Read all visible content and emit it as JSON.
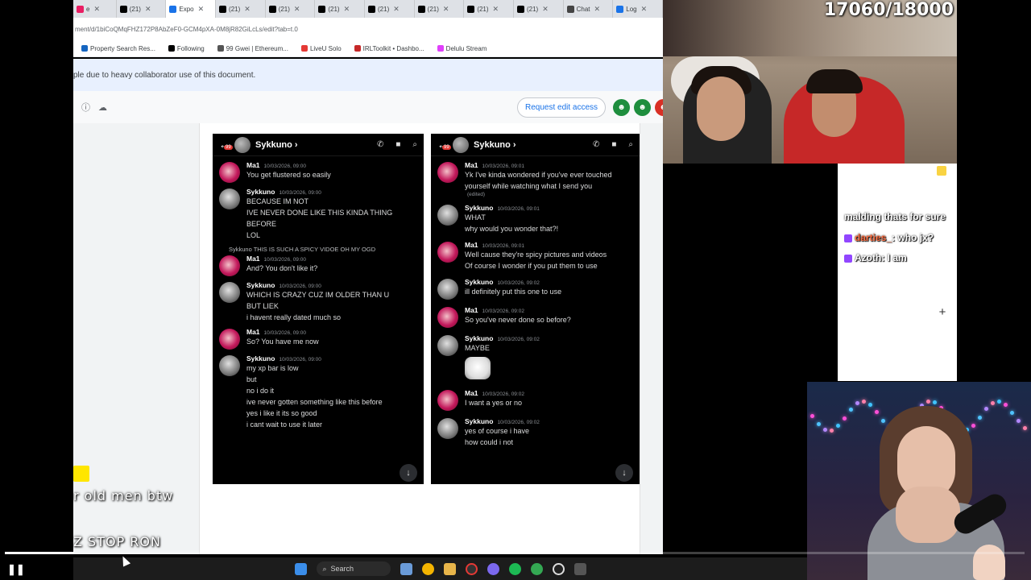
{
  "tabs": [
    {
      "label": "e",
      "active": false,
      "color": "#e91e63"
    },
    {
      "label": "(21)",
      "active": false,
      "color": "#000000"
    },
    {
      "label": "Expo",
      "active": true,
      "color": "#1a73e8"
    },
    {
      "label": "(21)",
      "active": false,
      "color": "#000000"
    },
    {
      "label": "(21)",
      "active": false,
      "color": "#000000"
    },
    {
      "label": "(21)",
      "active": false,
      "color": "#000000"
    },
    {
      "label": "(21)",
      "active": false,
      "color": "#000000"
    },
    {
      "label": "(21)",
      "active": false,
      "color": "#000000"
    },
    {
      "label": "(21)",
      "active": false,
      "color": "#000000"
    },
    {
      "label": "(21)",
      "active": false,
      "color": "#000000"
    },
    {
      "label": "Chat",
      "active": false,
      "color": "#444444"
    },
    {
      "label": "Log",
      "active": false,
      "color": "#1a73e8"
    }
  ],
  "address": {
    "url": "ment/d/1biCoQMqFHZ172P8AbZeF0-GCM4pXA-0M8jR82GiLcLs/edit?tab=t.0"
  },
  "bookmarks": [
    {
      "label": "Property Search Res...",
      "color": "#1565c0"
    },
    {
      "label": "Following",
      "color": "#000000"
    },
    {
      "label": "99 Gwei | Ethereum...",
      "color": "#555555"
    },
    {
      "label": "LiveU Solo",
      "color": "#e53935"
    },
    {
      "label": "IRLToolkit • Dashbo...",
      "color": "#c62828"
    },
    {
      "label": "Delulu Stream",
      "color": "#e040fb"
    }
  ],
  "notice": {
    "text": "ple due to heavy collaborator use of this document."
  },
  "doc_toolbar": {
    "request_label": "Request edit access"
  },
  "chat_left": {
    "contact": "Sykkuno",
    "badge": "99",
    "messages": [
      {
        "author": "Ma1",
        "time": "10/03/2026, 09:00",
        "lines": [
          "You get flustered so easily"
        ]
      },
      {
        "author": "Sykkuno",
        "time": "10/03/2026, 09:00",
        "lines": [
          "BECAUSE IM NOT",
          "IVE NEVER DONE LIKE THIS KINDA THING",
          "BEFORE",
          "LOL"
        ]
      },
      {
        "author": "Ma1",
        "time": "10/03/2026, 09:00",
        "lines": [
          "And? You don't like it?"
        ],
        "reply": "Sykkuno THIS IS SUCH A SPICY VIDOE OH MY OGD"
      },
      {
        "author": "Sykkuno",
        "time": "10/03/2026, 09:00",
        "lines": [
          "WHICH IS CRAZY CUZ IM OLDER THAN U",
          "BUT LIEK",
          "i havent really dated much so"
        ]
      },
      {
        "author": "Ma1",
        "time": "10/03/2026, 09:00",
        "lines": [
          "So? You have me now"
        ]
      },
      {
        "author": "Sykkuno",
        "time": "10/03/2026, 09:00",
        "lines": [
          "my xp bar is low",
          "but",
          "no i do it",
          "ive never gotten something like this before",
          "yes i like it its so good",
          "i cant wait to use it later"
        ]
      }
    ]
  },
  "chat_right": {
    "contact": "Sykkuno",
    "badge": "99",
    "messages": [
      {
        "author": "Ma1",
        "time": "10/03/2026, 09:01",
        "lines": [
          "Yk I've kinda wondered if you've ever touched",
          "yourself while watching what I send you"
        ],
        "edited": "(edited)"
      },
      {
        "author": "Sykkuno",
        "time": "10/03/2026, 09:01",
        "lines": [
          "WHAT",
          "why would you wonder that?!"
        ]
      },
      {
        "author": "Ma1",
        "time": "10/03/2026, 09:01",
        "lines": [
          "Well cause they're spicy pictures and videos",
          "Of course I wonder if you put them to use"
        ]
      },
      {
        "author": "Sykkuno",
        "time": "10/03/2026, 09:02",
        "lines": [
          "ill definitely put this one to use"
        ]
      },
      {
        "author": "Ma1",
        "time": "10/03/2026, 09:02",
        "lines": [
          "So you've never done so before?"
        ]
      },
      {
        "author": "Sykkuno",
        "time": "10/03/2026, 09:02",
        "lines": [
          "MAYBE"
        ],
        "sticker": true
      },
      {
        "author": "Ma1",
        "time": "10/03/2026, 09:02",
        "lines": [
          "I want a yes or no"
        ]
      },
      {
        "author": "Sykkuno",
        "time": "10/03/2026, 09:02",
        "lines": [
          "yes of course i have",
          "how could i not"
        ]
      }
    ]
  },
  "stream": {
    "counter": "17060/18000",
    "chat": [
      {
        "text": "malding thats for sure"
      },
      {
        "user": "darties_",
        "user_color": "#ff7043",
        "text": ": who jx?"
      },
      {
        "user": "Azoth",
        "user_color": "#ffffff",
        "text": ": I am"
      }
    ],
    "overlay_lines": [
      "r old men btw",
      "Z STOP RON"
    ]
  },
  "taskbar": {
    "search_label": "Search"
  }
}
